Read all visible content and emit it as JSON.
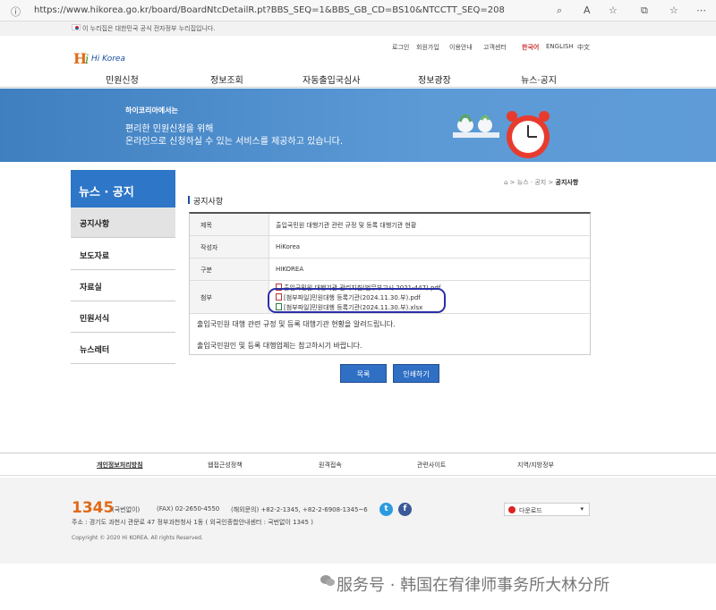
{
  "browser": {
    "url": "https://www.hikorea.go.kr/board/BoardNtcDetailR.pt?BBS_SEQ=1&BBS_GB_CD=BS10&NTCCTT_SEQ=208"
  },
  "gov_notice": "이 누리집은 대한민국 공식 전자정부 누리집입니다.",
  "header": {
    "logo_text": "Hi Korea",
    "top_links": [
      "로그인",
      "회원가입",
      "이용안내",
      "고객센터",
      "한국어",
      "ENGLISH",
      "中文"
    ],
    "nav": [
      "민원신청",
      "정보조회",
      "자동출입국심사",
      "정보광장",
      "뉴스·공지"
    ]
  },
  "banner": {
    "eyebrow": "하이코리아에서는",
    "line1": "편리한 민원신청을 위해",
    "line2": "온라인으로 신청하실 수 있는 서비스를 제공하고 있습니다."
  },
  "sidebar": {
    "title": "뉴스 · 공지",
    "items": [
      "공지사항",
      "보도자료",
      "자료실",
      "민원서식",
      "뉴스레터"
    ]
  },
  "breadcrumb": {
    "home": "⌂",
    "level1": "뉴스 · 공지",
    "current": "공지사항"
  },
  "section_title": "공지사항",
  "detail": {
    "rows": [
      {
        "label": "제목",
        "value": "출입국민원 대행기관 관련 규정 및 등록 대행기관 현황"
      },
      {
        "label": "작성자",
        "value": "HiKorea"
      },
      {
        "label": "구분",
        "value": "HIKOREA"
      },
      {
        "label": "첨부",
        "files": [
          "출입국민원 대행기관 관리지침(법무부고시 2021-447).pdf",
          "[첨부파일]민원대행 등록기관(2024.11.30.부).pdf",
          "[첨부파일]민원대행 등록기관(2024.11.30.부).xlsx"
        ]
      }
    ],
    "content": [
      "출입국민원 대행 관련 규정 및 등록 대행기관 현황을 알려드립니다.",
      "출입국민원인 및 등록 대행업체는 참고하시기 바랍니다."
    ]
  },
  "buttons": {
    "list": "목록",
    "print": "인쇄하기"
  },
  "footer": {
    "links": [
      "개인정보처리방침",
      "웹접근성정책",
      "원격접속",
      "관련사이트",
      "지역/지방정부"
    ],
    "phone": "1345",
    "phone_note": "(국번없이)",
    "fax": "(FAX) 02-2650-4550",
    "overseas": "(해외문의) +82-2-1345, +82-2-6908-1345~6",
    "address": "주소 : 경기도 과천시 관문로 47 정부과천청사 1동 ( 외국인종합안내센터 : 국번없이 1345 )",
    "copyright": "Copyright © 2020 Hi KOREA. All rights Reserved.",
    "download": "다운로드"
  },
  "watermark": "服务号 · 韩国在宥律师事务所大林分所",
  "colors": {
    "brand_blue": "#2e76c7",
    "accent_orange": "#e06a16",
    "circle": "#2b2fa8"
  }
}
